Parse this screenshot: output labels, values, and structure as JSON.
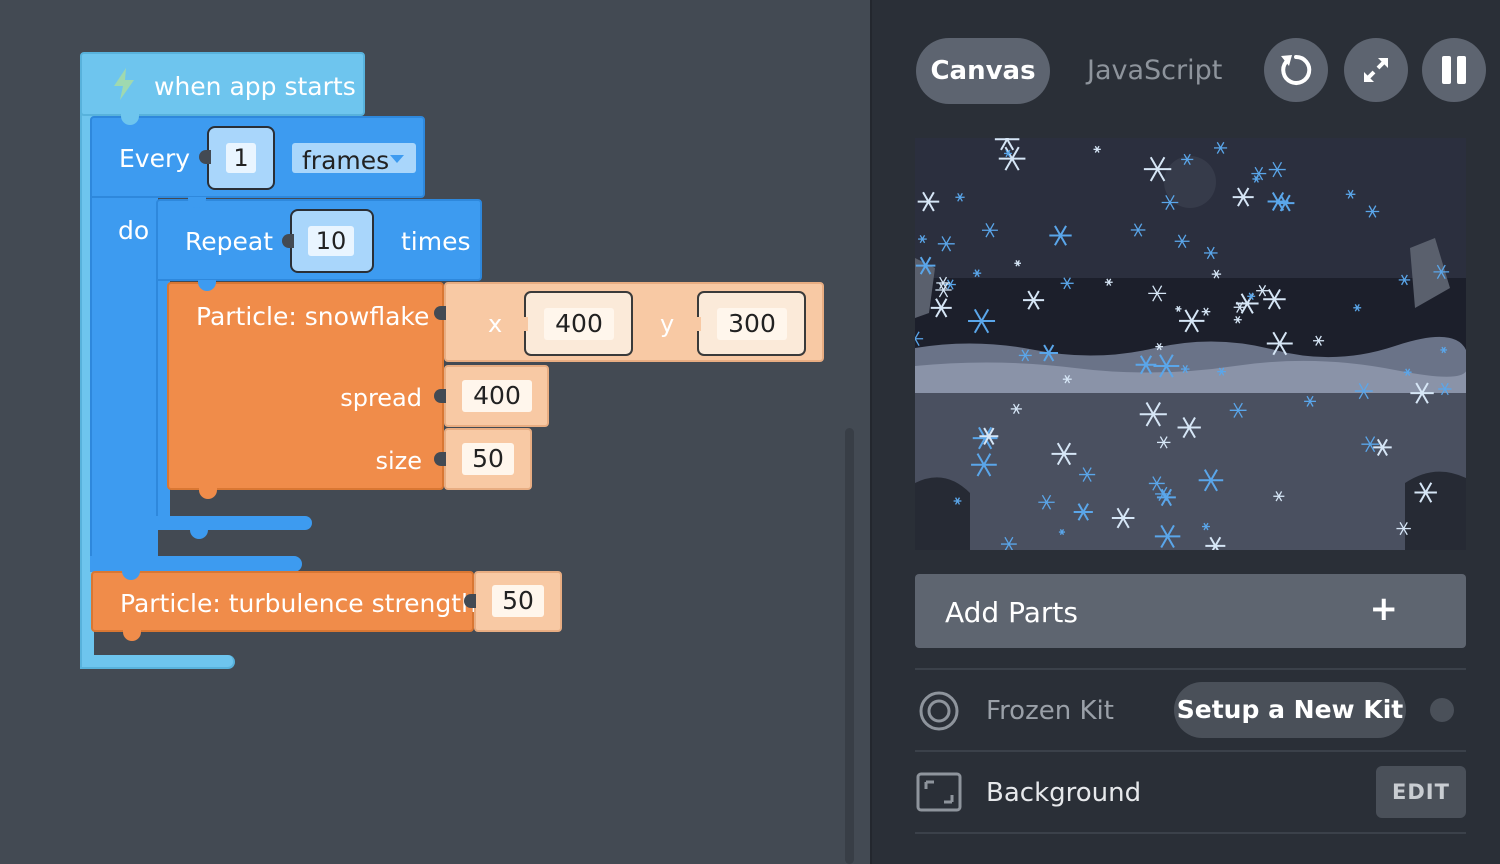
{
  "workspace": {
    "hat": {
      "label": "when app starts",
      "icon": "lightning-icon"
    },
    "every": {
      "label": "Every",
      "value": "1",
      "dropdown": "frames",
      "do_label": "do"
    },
    "repeat": {
      "label": "Repeat",
      "value": "10",
      "suffix": "times"
    },
    "snowflake": {
      "label": "Particle: snowflake",
      "x_label": "x",
      "x_value": "400",
      "y_label": "y",
      "y_value": "300",
      "spread_label": "spread",
      "spread_value": "400",
      "size_label": "size",
      "size_value": "50"
    },
    "turbulence": {
      "label": "Particle: turbulence strength",
      "value": "50"
    }
  },
  "panel": {
    "tabs": {
      "canvas": "Canvas",
      "javascript": "JavaScript"
    },
    "buttons": {
      "restart": "restart-icon",
      "fullscreen": "fullscreen-icon",
      "pause": "pause-icon"
    },
    "add_parts": {
      "label": "Add Parts",
      "plus": "+"
    },
    "kit": {
      "label": "Frozen Kit",
      "button": "Setup a New Kit"
    },
    "background": {
      "label": "Background",
      "button": "EDIT"
    }
  },
  "colors": {
    "event": "#6ec5ee",
    "control": "#3d9bf0",
    "particle": "#f08c4a",
    "panel_bg": "#2a2f37",
    "workspace_bg": "#434a53"
  }
}
